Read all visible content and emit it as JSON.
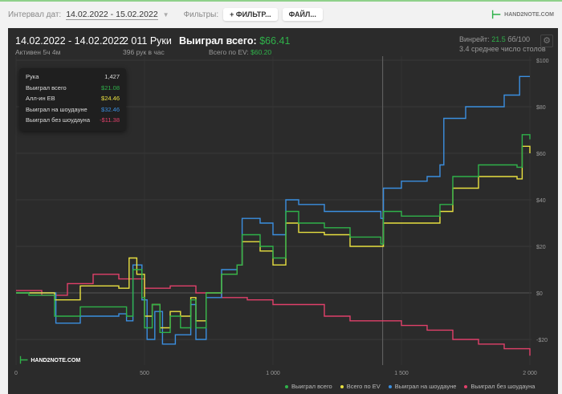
{
  "toolbar": {
    "date_label": "Интервал дат:",
    "date_value": "14.02.2022 - 15.02.2022",
    "filters_label": "Фильтры:",
    "filter_button": "ФИЛЬТР...",
    "file_button": "ФАЙЛ..."
  },
  "logo": "HAND2NOTE.COM",
  "summary": {
    "period": "14.02.2022 - 14.02.2022",
    "active": "Активен 5ч 4м",
    "hands": "2 011 Руки",
    "hands_per_hour": "396 рук в час",
    "won_label": "Выиграл всего:",
    "won_value": "$66.41",
    "ev_label": "Всего по EV:",
    "ev_value": "$60.20",
    "winrate_label": "Винрейт:",
    "winrate_value": "21.5",
    "winrate_unit": "бб/100",
    "tables": "3.4 среднее число столов"
  },
  "tooltip": [
    {
      "label": "Рука",
      "value": "1,427",
      "color": "#dddddd"
    },
    {
      "label": "Выиграл всего",
      "value": "$21.08",
      "color": "#2fb24a"
    },
    {
      "label": "Алл-ин EB",
      "value": "$24.46",
      "color": "#e8e040"
    },
    {
      "label": "Выиграл на шоудауне",
      "value": "$32.46",
      "color": "#3b8fe0"
    },
    {
      "label": "Выиграл без шоудауна",
      "value": "-$11.38",
      "color": "#e0406a"
    }
  ],
  "watermark": "HAND2NOTE.COM",
  "chart_data": {
    "type": "line",
    "xlabel": "",
    "ylabel": "",
    "xlim": [
      0,
      2000
    ],
    "ylim": [
      -27,
      102
    ],
    "x_ticks": [
      {
        "v": 0,
        "label": "0"
      },
      {
        "v": 500,
        "label": "500"
      },
      {
        "v": 1000,
        "label": "1 000"
      },
      {
        "v": 1500,
        "label": "1 500"
      },
      {
        "v": 2000,
        "label": "2 000"
      }
    ],
    "y_ticks": [
      {
        "v": 100,
        "label": "$100"
      },
      {
        "v": 80,
        "label": "$80"
      },
      {
        "v": 60,
        "label": "$60"
      },
      {
        "v": 40,
        "label": "$40"
      },
      {
        "v": 20,
        "label": "$20"
      },
      {
        "v": 0,
        "label": "$0"
      },
      {
        "v": -20,
        "label": "-$20"
      }
    ],
    "legend_position": "bottom-right",
    "series": [
      {
        "name": "Выиграл всего",
        "color": "#2fb24a",
        "points": [
          [
            0,
            0
          ],
          [
            50,
            -1
          ],
          [
            150,
            -10
          ],
          [
            250,
            -6
          ],
          [
            400,
            -6
          ],
          [
            430,
            -10
          ],
          [
            455,
            10
          ],
          [
            490,
            -2
          ],
          [
            500,
            -15
          ],
          [
            530,
            -5
          ],
          [
            560,
            -17
          ],
          [
            600,
            -10
          ],
          [
            640,
            -15
          ],
          [
            680,
            -3
          ],
          [
            700,
            -15
          ],
          [
            740,
            0
          ],
          [
            800,
            8
          ],
          [
            860,
            12
          ],
          [
            880,
            25
          ],
          [
            950,
            20
          ],
          [
            1000,
            15
          ],
          [
            1050,
            35
          ],
          [
            1100,
            30
          ],
          [
            1200,
            28
          ],
          [
            1300,
            24
          ],
          [
            1420,
            21
          ],
          [
            1430,
            35
          ],
          [
            1500,
            33
          ],
          [
            1600,
            33
          ],
          [
            1650,
            38
          ],
          [
            1700,
            50
          ],
          [
            1800,
            55
          ],
          [
            1950,
            54
          ],
          [
            1970,
            68
          ],
          [
            2000,
            66
          ]
        ]
      },
      {
        "name": "Всего по EV",
        "color": "#e8e040",
        "points": [
          [
            0,
            0
          ],
          [
            50,
            0
          ],
          [
            150,
            -3
          ],
          [
            250,
            3
          ],
          [
            400,
            2
          ],
          [
            440,
            15
          ],
          [
            470,
            8
          ],
          [
            500,
            -10
          ],
          [
            530,
            -5
          ],
          [
            560,
            -15
          ],
          [
            600,
            -8
          ],
          [
            640,
            -10
          ],
          [
            680,
            -2
          ],
          [
            700,
            -12
          ],
          [
            740,
            0
          ],
          [
            800,
            8
          ],
          [
            860,
            12
          ],
          [
            880,
            22
          ],
          [
            950,
            18
          ],
          [
            1000,
            12
          ],
          [
            1050,
            30
          ],
          [
            1100,
            26
          ],
          [
            1200,
            25
          ],
          [
            1300,
            20
          ],
          [
            1420,
            20
          ],
          [
            1430,
            30
          ],
          [
            1500,
            30
          ],
          [
            1600,
            30
          ],
          [
            1650,
            35
          ],
          [
            1700,
            45
          ],
          [
            1800,
            50
          ],
          [
            1950,
            49
          ],
          [
            1970,
            63
          ],
          [
            2000,
            60
          ]
        ]
      },
      {
        "name": "Выиграл на шоудауне",
        "color": "#3b8fe0",
        "points": [
          [
            0,
            0
          ],
          [
            140,
            0
          ],
          [
            155,
            -13
          ],
          [
            250,
            -10
          ],
          [
            400,
            -9
          ],
          [
            430,
            -12
          ],
          [
            455,
            12
          ],
          [
            490,
            -3
          ],
          [
            510,
            -20
          ],
          [
            540,
            -8
          ],
          [
            570,
            -22
          ],
          [
            620,
            -18
          ],
          [
            680,
            -5
          ],
          [
            700,
            -20
          ],
          [
            740,
            -2
          ],
          [
            800,
            10
          ],
          [
            860,
            12
          ],
          [
            880,
            32
          ],
          [
            950,
            30
          ],
          [
            1000,
            25
          ],
          [
            1050,
            40
          ],
          [
            1100,
            38
          ],
          [
            1200,
            35
          ],
          [
            1300,
            35
          ],
          [
            1420,
            32
          ],
          [
            1430,
            45
          ],
          [
            1500,
            48
          ],
          [
            1600,
            50
          ],
          [
            1650,
            55
          ],
          [
            1665,
            75
          ],
          [
            1750,
            80
          ],
          [
            1900,
            85
          ],
          [
            1960,
            93
          ],
          [
            2000,
            93
          ]
        ]
      },
      {
        "name": "Выиграл без шоудауна",
        "color": "#e0406a",
        "points": [
          [
            0,
            1
          ],
          [
            100,
            -1
          ],
          [
            200,
            4
          ],
          [
            300,
            8
          ],
          [
            400,
            6
          ],
          [
            500,
            2
          ],
          [
            600,
            3
          ],
          [
            700,
            0
          ],
          [
            800,
            -2
          ],
          [
            900,
            -3
          ],
          [
            1000,
            -5
          ],
          [
            1100,
            -5
          ],
          [
            1200,
            -10
          ],
          [
            1300,
            -12
          ],
          [
            1400,
            -12
          ],
          [
            1500,
            -14
          ],
          [
            1600,
            -16
          ],
          [
            1700,
            -20
          ],
          [
            1800,
            -22
          ],
          [
            1900,
            -24
          ],
          [
            2000,
            -27
          ]
        ]
      }
    ]
  }
}
